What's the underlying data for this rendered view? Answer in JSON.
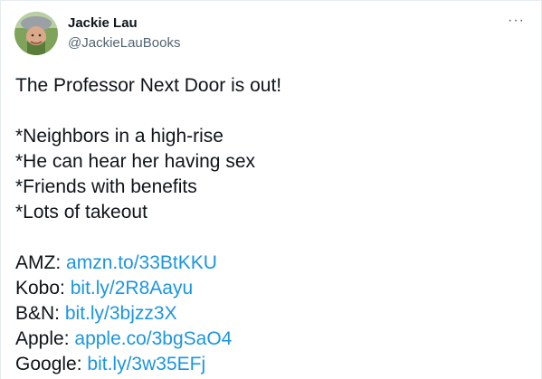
{
  "author": {
    "name": "Jackie Lau",
    "handle": "@JackieLauBooks"
  },
  "more_icon": "···",
  "tweet": {
    "headline": "The Professor Next Door is out!",
    "bullets": [
      "*Neighbors in a high-rise",
      "*He can hear her having sex",
      "*Friends with benefits",
      "*Lots of takeout"
    ],
    "links": [
      {
        "label": "AMZ:",
        "url": "amzn.to/33BtKKU"
      },
      {
        "label": "Kobo:",
        "url": "bit.ly/2R8Aayu"
      },
      {
        "label": "B&N:",
        "url": "bit.ly/3bjzz3X"
      },
      {
        "label": "Apple:",
        "url": "apple.co/3bgSaO4"
      },
      {
        "label": "Google:",
        "url": "bit.ly/3w35EFj"
      }
    ]
  },
  "colors": {
    "text": "#0f1419",
    "secondary": "#536471",
    "link": "#1b95e0"
  }
}
